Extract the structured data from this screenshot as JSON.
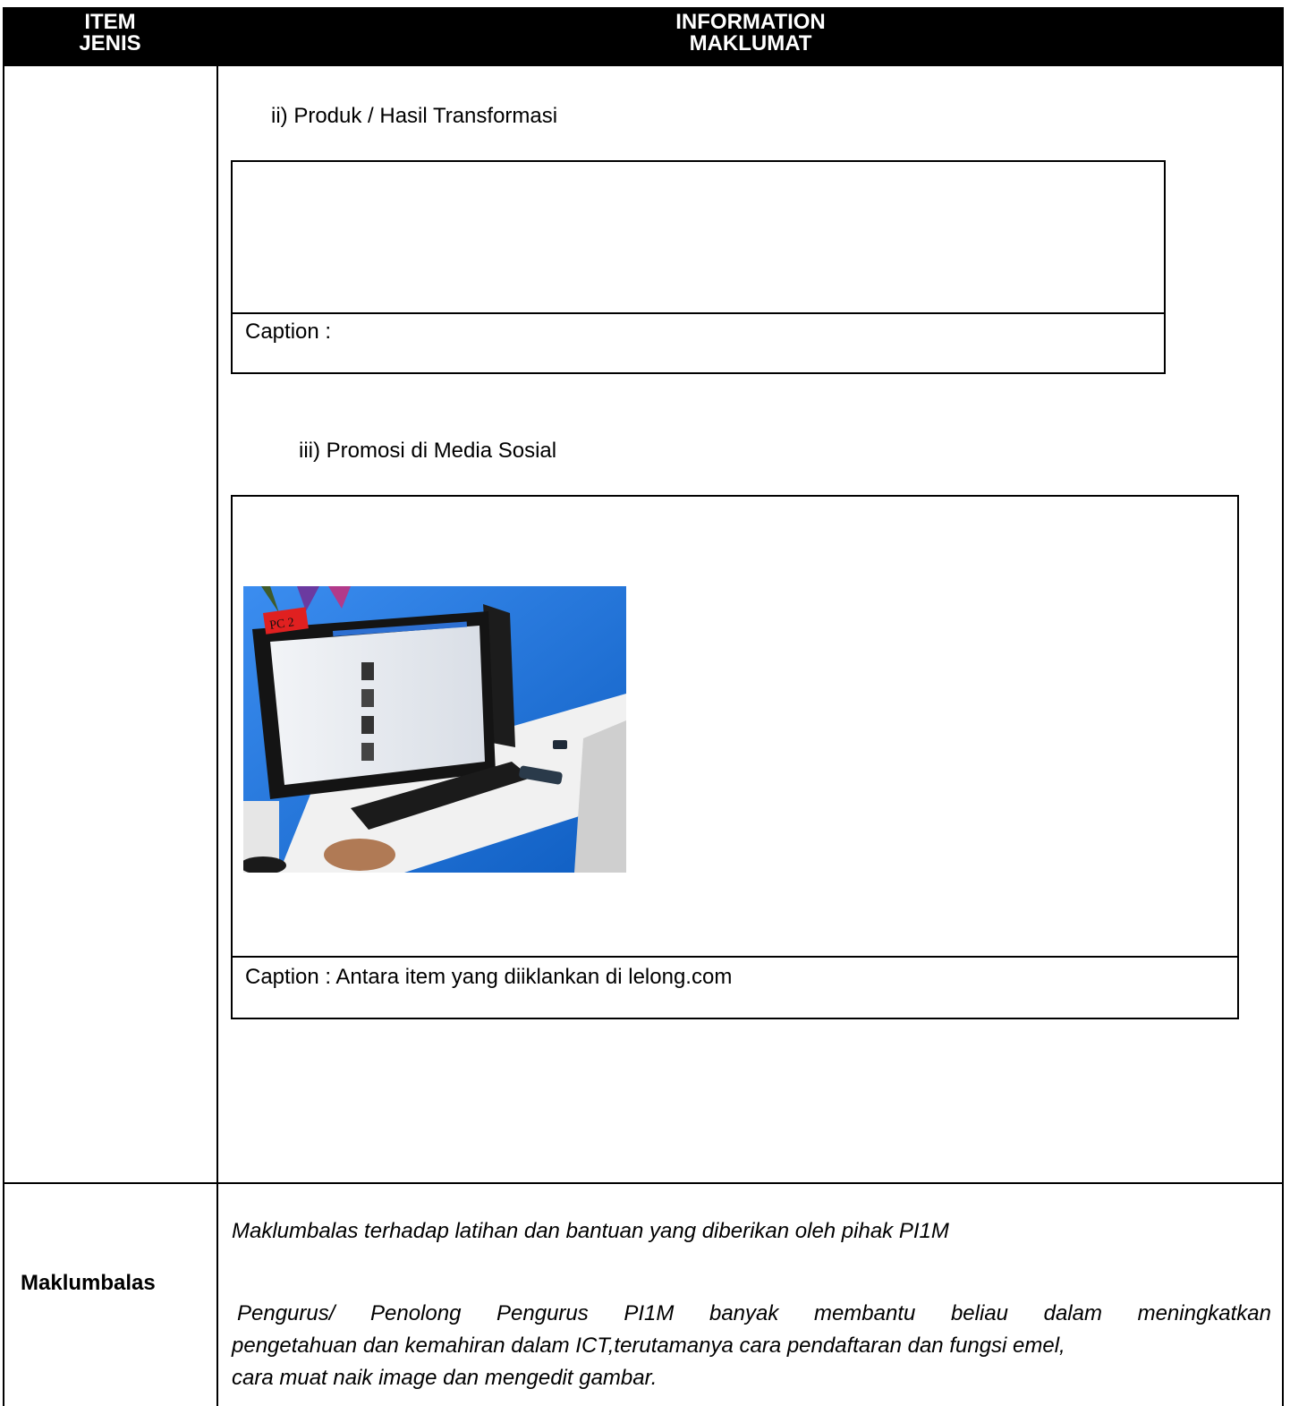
{
  "table": {
    "header": {
      "col1_line1": "ITEM",
      "col1_line2": "JENIS",
      "col2_line1": "INFORMATION",
      "col2_line2": "MAKLUMAT"
    },
    "section_ii": {
      "title": "ii)    Produk / Hasil Transformasi",
      "caption": "Caption :"
    },
    "section_iii": {
      "title": "iii)  Promosi di Media Sosial",
      "caption": "Caption : Antara item yang diiklankan di lelong.com",
      "photo": {
        "label": "PC 2"
      }
    },
    "feedback": {
      "label": "Maklumbalas",
      "intro": "Maklumbalas terhadap latihan dan bantuan yang diberikan oleh pihak PI1M",
      "line1": "Pengurus/ Penolong Pengurus PI1M banyak membantu beliau dalam meningkatkan",
      "line2": "pengetahuan dan kemahiran dalam ICT,terutamanya cara pendaftaran dan fungsi emel,",
      "line3": "cara muat naik image dan mengedit gambar."
    }
  },
  "colors": {
    "header_bg": "#000000",
    "header_text": "#ffffff",
    "photo_wall": "#1e73d6"
  },
  "icons": [
    "computer-photo"
  ]
}
